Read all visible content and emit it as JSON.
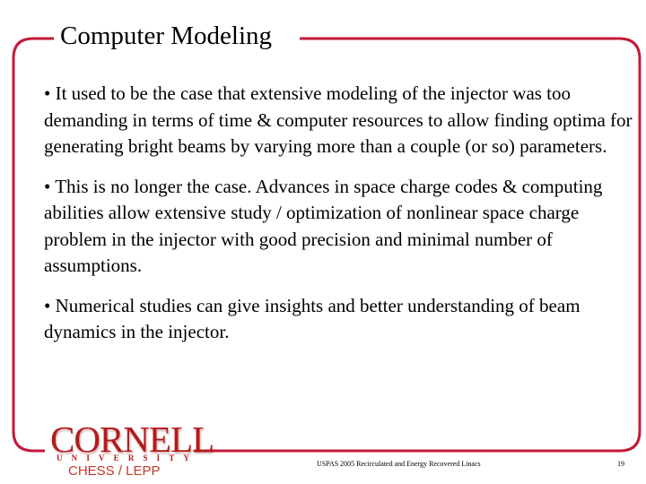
{
  "slide": {
    "title": "Computer Modeling",
    "accent_color": "#c41a3b",
    "bullets": [
      "• It used to be the case that extensive modeling of the injector was too demanding in terms of time & computer resources to allow finding optima for generating bright beams by varying more than a couple (or so) parameters.",
      "• This is no longer the case. Advances in space charge codes & computing abilities allow extensive study / optimization of nonlinear space charge problem in the injector with good precision and minimal number of assumptions.",
      "• Numerical studies can give insights and better understanding of beam dynamics in the injector."
    ]
  },
  "logo": {
    "wordmark": "CORNELL",
    "subtitle_letters": [
      "U",
      "N",
      "I",
      "V",
      "E",
      "R",
      "S",
      "I",
      "T",
      "Y"
    ],
    "department": "CHESS / LEPP"
  },
  "footer": {
    "course": "USPAS 2005 Recirculated and Energy Recovered Linacs",
    "page_number": "19"
  }
}
